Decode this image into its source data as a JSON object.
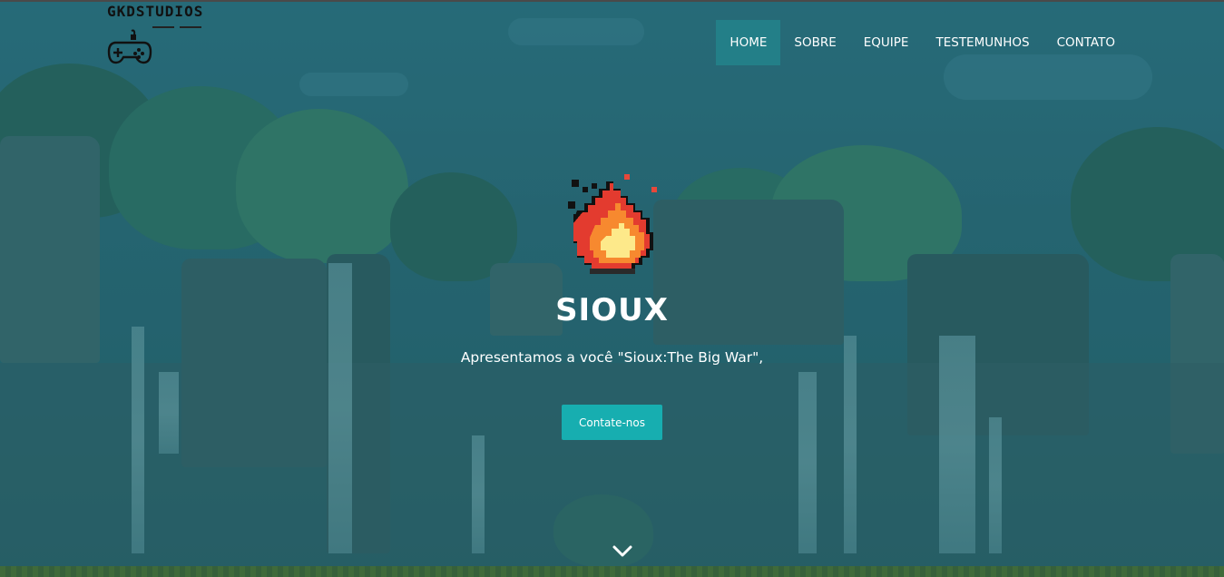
{
  "brand": {
    "name": "GKDSTUDIOS",
    "logo_icon": "gamepad-icon"
  },
  "nav": {
    "items": [
      {
        "label": "HOME",
        "active": true
      },
      {
        "label": "SOBRE",
        "active": false
      },
      {
        "label": "EQUIPE",
        "active": false
      },
      {
        "label": "TESTEMUNHOS",
        "active": false
      },
      {
        "label": "CONTATO",
        "active": false
      }
    ]
  },
  "hero": {
    "icon": "fire-icon",
    "title": "SIOUX",
    "subtitle": "Apresentamos a você \"Sioux:The Big War\",",
    "cta_label": "Contate-nos",
    "scroll_icon": "chevron-down-icon"
  },
  "colors": {
    "nav_active": "#237f88",
    "cta": "#17aeb0",
    "overlay": "#1c6470"
  }
}
